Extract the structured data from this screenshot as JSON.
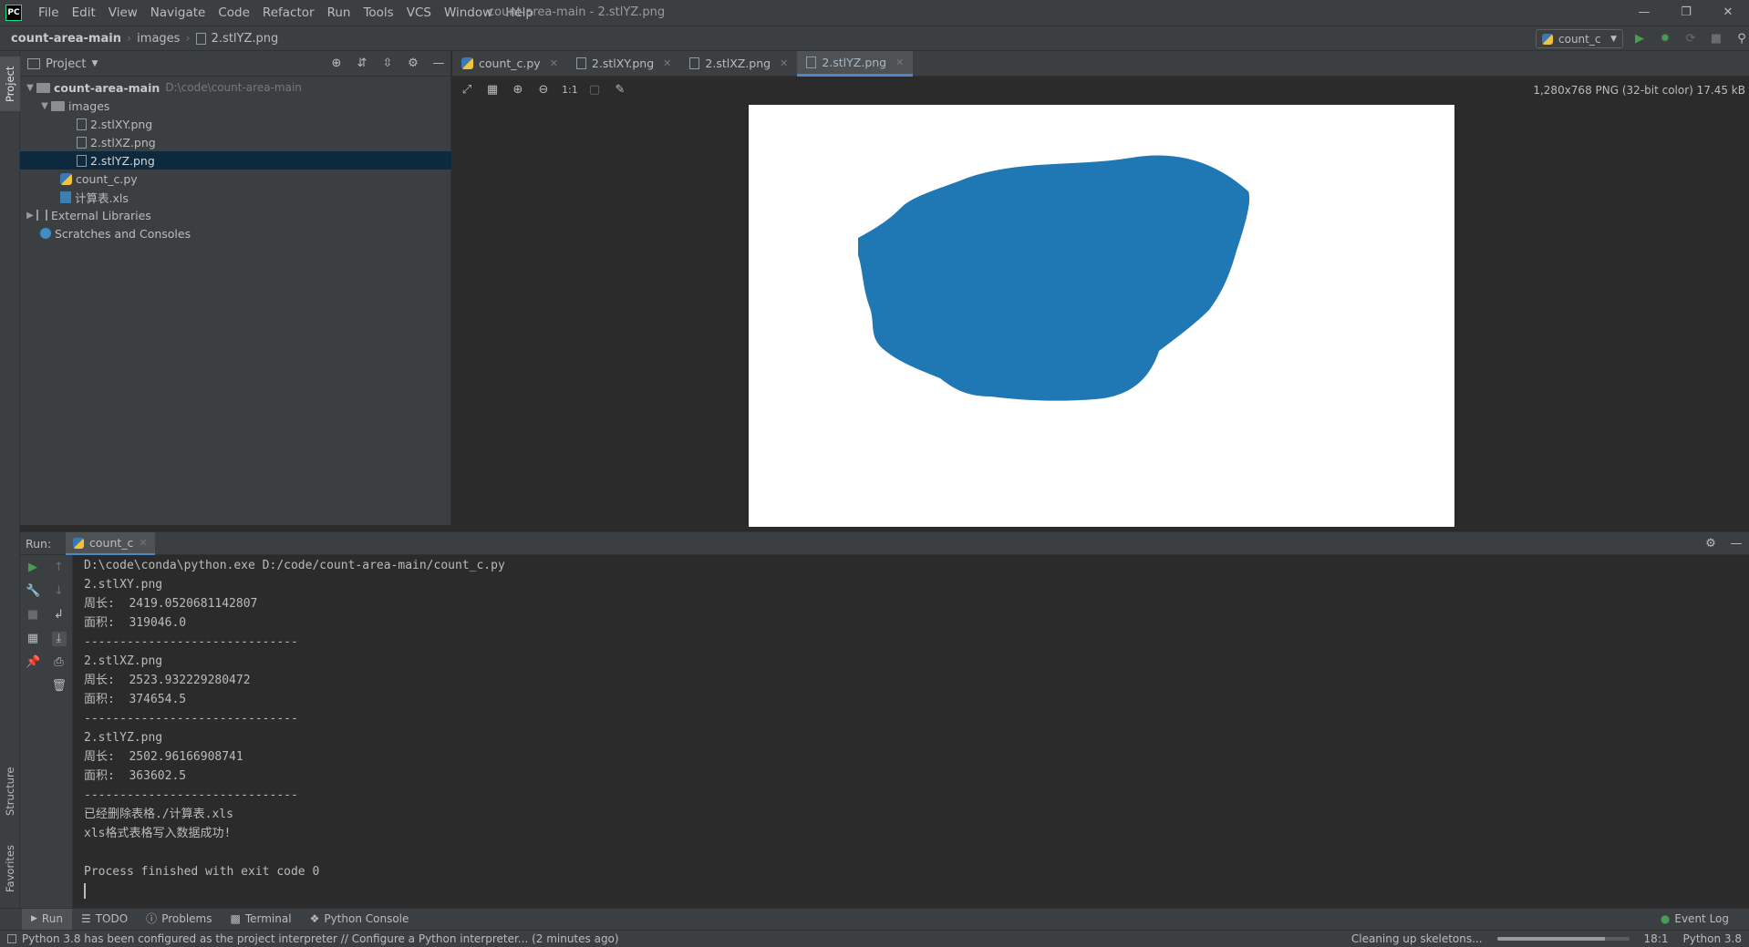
{
  "menubar": {
    "logo": "PC",
    "items": [
      "File",
      "Edit",
      "View",
      "Navigate",
      "Code",
      "Refactor",
      "Run",
      "Tools",
      "VCS",
      "Window",
      "Help"
    ],
    "window_title": "count-area-main - 2.stlYZ.png"
  },
  "navbar": {
    "breadcrumbs": [
      "count-area-main",
      "images",
      "2.stlYZ.png"
    ],
    "run_config": "count_c"
  },
  "left_strip": {
    "project": "Project",
    "structure": "Structure",
    "favorites": "Favorites"
  },
  "project_panel": {
    "title": "Project",
    "tree": [
      {
        "label": "count-area-main",
        "hint": "D:\\code\\count-area-main"
      },
      {
        "label": "images"
      },
      {
        "label": "2.stlXY.png"
      },
      {
        "label": "2.stlXZ.png"
      },
      {
        "label": "2.stlYZ.png"
      },
      {
        "label": "count_c.py"
      },
      {
        "label": "计算表.xls"
      },
      {
        "label": "External Libraries"
      },
      {
        "label": "Scratches and Consoles"
      }
    ]
  },
  "editor_tabs": [
    "count_c.py",
    "2.stlXY.png",
    "2.stlXZ.png",
    "2.stlYZ.png"
  ],
  "viewer": {
    "image_info": "1,280x768 PNG (32-bit color) 17.45 kB",
    "zoom_label": "1:1",
    "shape_color": "#1f77b4"
  },
  "run_panel": {
    "label": "Run:",
    "tab": "count_c",
    "console": [
      "D:\\code\\conda\\python.exe D:/code/count-area-main/count_c.py",
      "2.stlXY.png",
      "周长:  2419.0520681142807",
      "面积:  319046.0",
      "------------------------------",
      "2.stlXZ.png",
      "周长:  2523.932229280472",
      "面积:  374654.5",
      "------------------------------",
      "2.stlYZ.png",
      "周长:  2502.96166908741",
      "面积:  363602.5",
      "------------------------------",
      "已经删除表格./计算表.xls",
      "xls格式表格写入数据成功!",
      "",
      "Process finished with exit code 0"
    ]
  },
  "bottom_tabs": [
    "Run",
    "TODO",
    "Problems",
    "Terminal",
    "Python Console"
  ],
  "event_log": "Event Log",
  "status": {
    "message": "Python 3.8 has been configured as the project interpreter // Configure a Python interpreter... (2 minutes ago)",
    "task": "Cleaning up skeletons...",
    "progress": 0.82,
    "position": "18:1",
    "interpreter": "Python 3.8"
  }
}
